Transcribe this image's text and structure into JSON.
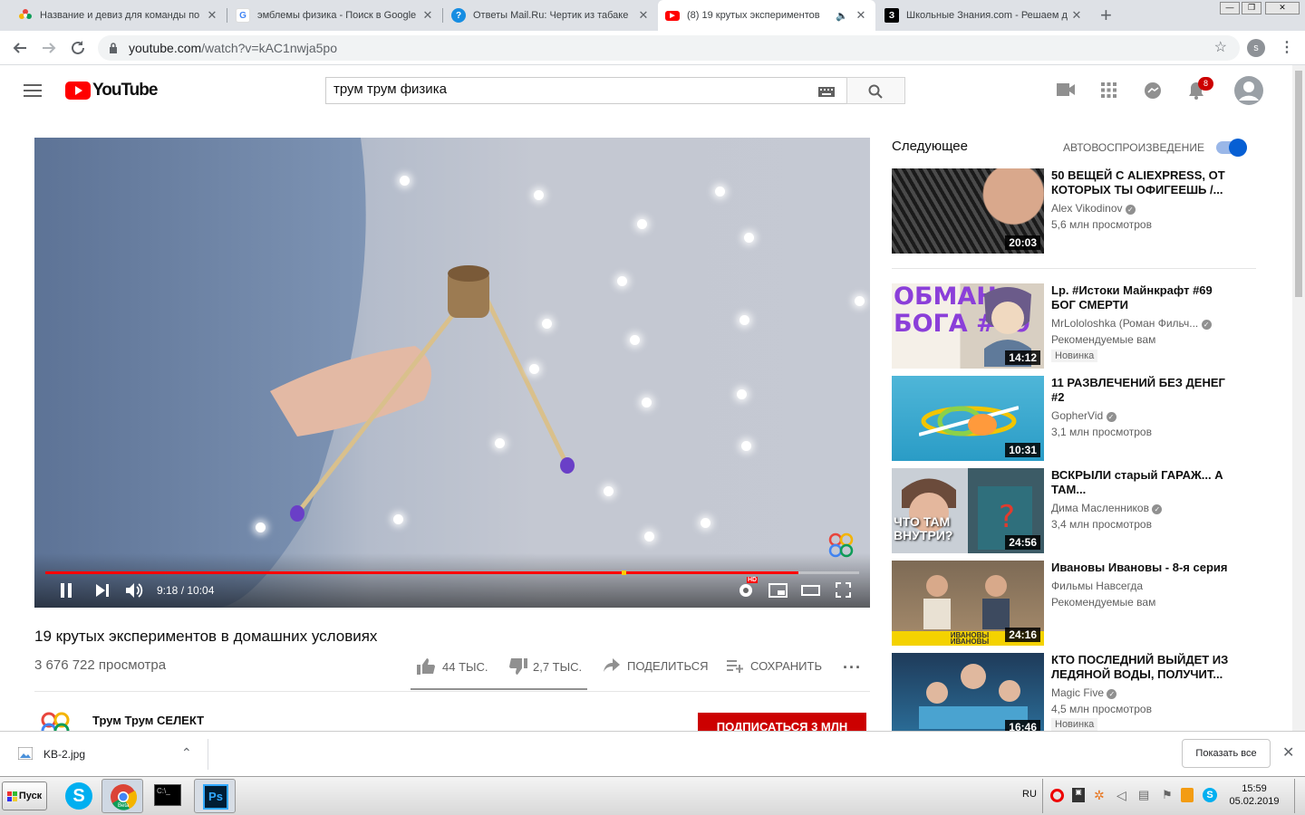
{
  "tabs": [
    {
      "title": "Название и девиз для команды по",
      "icon": "flower-favicon",
      "color": "#e8453c"
    },
    {
      "title": "эмблемы физика - Поиск в Google",
      "icon": "google-favicon",
      "color": "#4285f4"
    },
    {
      "title": "Ответы Mail.Ru: Чертик из табаке",
      "icon": "question-favicon",
      "color": "#168de2"
    },
    {
      "title": "(8) 19 крутых экспериментов",
      "icon": "youtube-favicon",
      "color": "#ff0000",
      "active": true
    },
    {
      "title": "Школьные Знания.com - Решаем д",
      "icon": "znanija-favicon",
      "color": "#000000"
    }
  ],
  "url": {
    "host": "youtube.com",
    "path": "/watch?v=kAC1nwja5po"
  },
  "profile_initial": "s",
  "search": {
    "query": "трум трум физика"
  },
  "notifications": "8",
  "player": {
    "time": "9:18 / 10:04",
    "progress": 0.925,
    "hd": "HD"
  },
  "video": {
    "title": "19 крутых экспериментов в домашних условиях",
    "views": "3 676 722 просмотра",
    "likes": "44 ТЫС.",
    "dislikes": "2,7 ТЫС.",
    "share": "ПОДЕЛИТЬСЯ",
    "save": "СОХРАНИТЬ",
    "channel": "Трум Трум СЕЛЕКТ",
    "subscribe": "ПОДПИСАТЬСЯ 3 МЛН"
  },
  "sidebar": {
    "heading": "Следующее",
    "autoplay": "АВТОВОСПРОИЗВЕДЕНИЕ",
    "items": [
      {
        "title": "50 ВЕЩЕЙ С ALIEXPRESS, ОТ КОТОРЫХ ТЫ ОФИГЕЕШЬ /...",
        "channel": "Alex Vikodinov",
        "meta": "5,6 млн просмотров",
        "duration": "20:03",
        "badge": ""
      },
      {
        "title": "Lp. #Истоки Майнкрафт #69 БОГ СМЕРТИ",
        "channel": "MrLololoshka (Роман Фильч...",
        "meta": "Рекомендуемые вам",
        "duration": "14:12",
        "badge": "Новинка",
        "thumb_text": "ОБМАН БОГА #69"
      },
      {
        "title": "11 РАЗВЛЕЧЕНИЙ БЕЗ ДЕНЕГ #2",
        "channel": "GopherVid",
        "meta": "3,1 млн просмотров",
        "duration": "10:31",
        "badge": ""
      },
      {
        "title": "ВСКРЫЛИ старый ГАРАЖ... А ТАМ...",
        "channel": "Дима Масленников",
        "meta": "3,4 млн просмотров",
        "duration": "24:56",
        "badge": "",
        "thumb_text": "ЧТО ТАМ ВНУТРИ?"
      },
      {
        "title": "Ивановы Ивановы - 8-я серия",
        "channel": "Фильмы Навсегда",
        "meta": "Рекомендуемые вам",
        "duration": "24:16",
        "badge": "",
        "thumb_text": "ИВАНОВЫ ИВАНОВЫ"
      },
      {
        "title": "КТО ПОСЛЕДНИЙ ВЫЙДЕТ ИЗ ЛЕДЯНОЙ ВОДЫ, ПОЛУЧИТ...",
        "channel": "Magic Five",
        "meta": "4,5 млн просмотров",
        "duration": "16:46",
        "badge": "Новинка"
      }
    ]
  },
  "download": {
    "file": "KB-2.jpg",
    "show_all": "Показать все"
  },
  "taskbar": {
    "start": "Пуск",
    "lang": "RU",
    "time": "15:59",
    "date": "05.02.2019",
    "chrome_badge": "Beta"
  }
}
